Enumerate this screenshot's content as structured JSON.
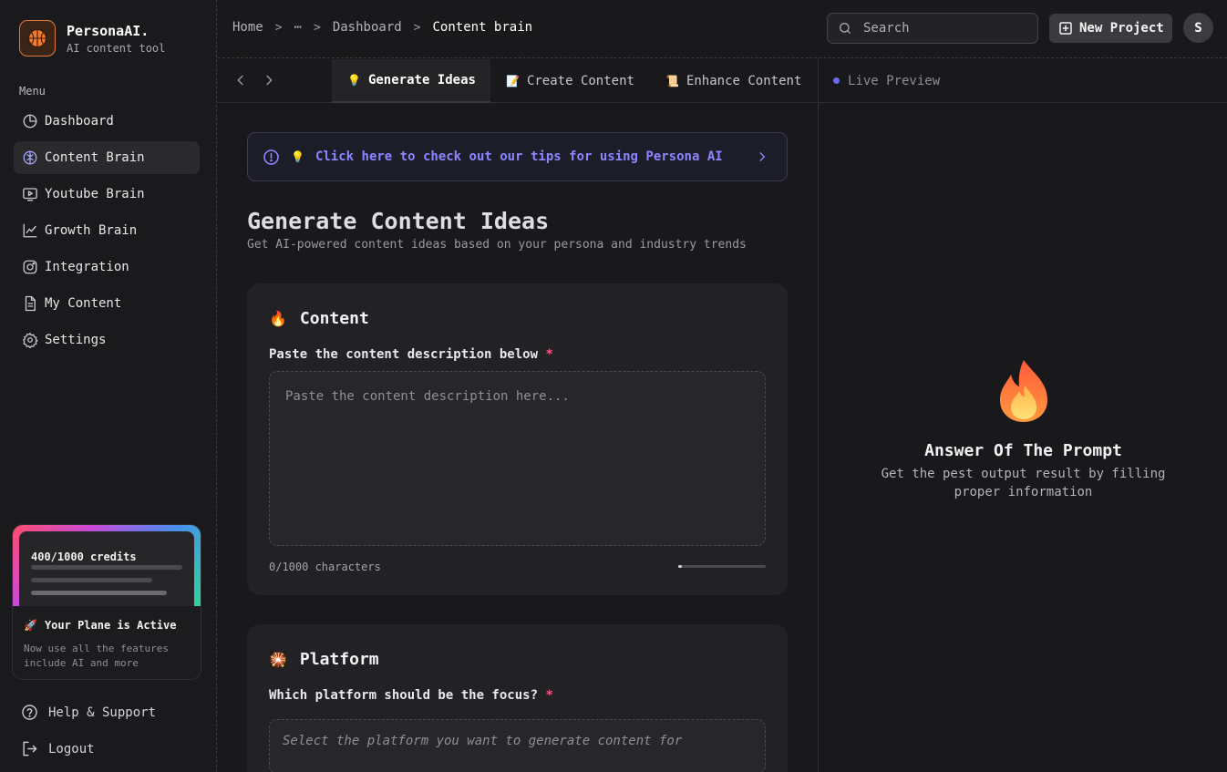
{
  "brand": {
    "name": "PersonaAI.",
    "subtitle": "AI content tool"
  },
  "sidebar": {
    "menu_label": "Menu",
    "items": [
      {
        "label": "Dashboard",
        "icon": "pie-chart-icon"
      },
      {
        "label": "Content Brain",
        "icon": "brain-icon",
        "active": true
      },
      {
        "label": "Youtube Brain",
        "icon": "video-icon"
      },
      {
        "label": "Growth Brain",
        "icon": "trend-chart-icon"
      },
      {
        "label": "Integration",
        "icon": "instagram-icon"
      },
      {
        "label": "My Content",
        "icon": "document-icon"
      },
      {
        "label": "Settings",
        "icon": "gear-icon"
      }
    ],
    "credits": {
      "label": "400/1000 credits",
      "used": 400,
      "total": 1000
    },
    "plan": {
      "title": "Your Plane is Active",
      "description": "Now use all the features include AI and more"
    },
    "help_label": "Help & Support",
    "logout_label": "Logout"
  },
  "header": {
    "breadcrumb": [
      "Home",
      "⋯",
      "Dashboard",
      "Content brain"
    ],
    "search_placeholder": "Search",
    "new_project_label": "New Project",
    "avatar_initial": "S"
  },
  "tabs": [
    {
      "label": "Generate Ideas",
      "emoji": "💡",
      "active": true
    },
    {
      "label": "Create Content",
      "emoji": "📝"
    },
    {
      "label": "Enhance Content",
      "emoji": "📜"
    }
  ],
  "live_preview_label": "Live Preview",
  "tips_banner": {
    "emoji": "💡",
    "text": "Click here to check out our tips for using Persona AI"
  },
  "main": {
    "title": "Generate Content Ideas",
    "subtitle": "Get AI-powered content ideas based on your persona and industry trends",
    "content_card": {
      "emoji": "🔥",
      "title": "Content",
      "label": "Paste the content description below",
      "placeholder": "Paste the content description here...",
      "char_count": "0/1000 characters"
    },
    "platform_card": {
      "emoji": "🎇",
      "title": "Platform",
      "label": "Which platform should be the focus?",
      "placeholder": "Select the platform you want to generate content for"
    }
  },
  "preview": {
    "title": "Answer Of The Prompt",
    "subtitle": "Get the pest output result by filling proper information"
  },
  "colors": {
    "accent": "#8c86ff",
    "required": "#ff4f7b",
    "brand": "#e07a3c",
    "background": "#19191b"
  }
}
